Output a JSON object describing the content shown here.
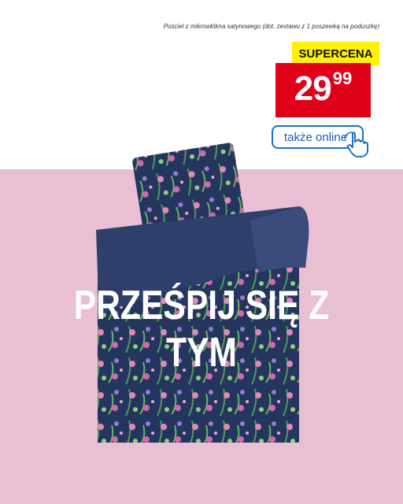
{
  "caption": "Pościel z mikrowłókna satynowego (dot. zestawu z 1 poszewką na poduszkę)",
  "badge": "SUPERCENA",
  "price": {
    "main": "29",
    "cents": "99"
  },
  "online_button": {
    "label": "także online",
    "icon": "hand-pointer-icon"
  },
  "headline": "PRZEŚPIJ SIĘ Z TYM",
  "colors": {
    "pink_bg": "#e8bfd3",
    "price_red": "#e1001a",
    "badge_yellow": "#fff200",
    "online_blue": "#1a73c7",
    "bedding_navy": "#2f3f6b"
  }
}
